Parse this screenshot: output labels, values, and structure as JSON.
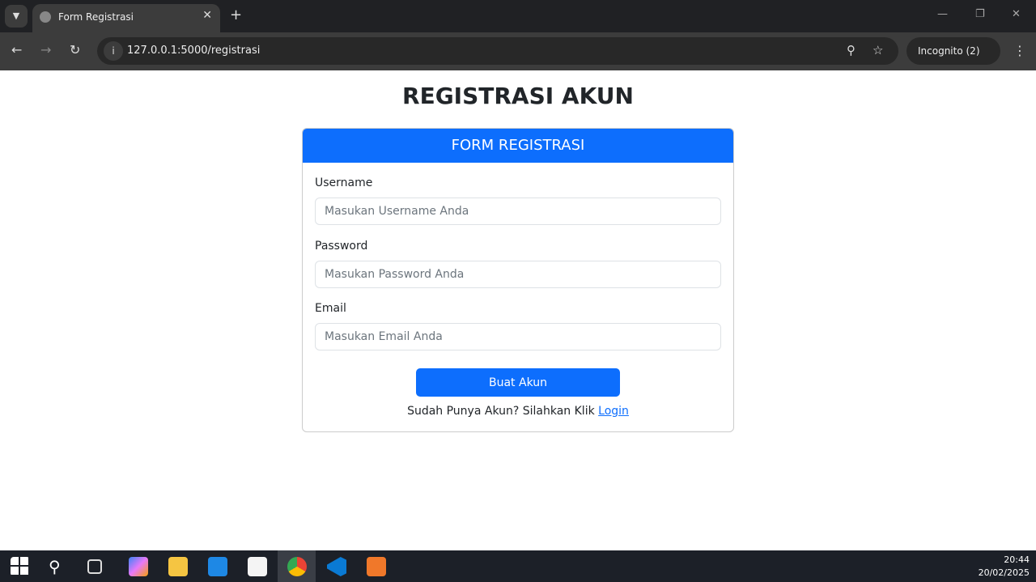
{
  "browser": {
    "tab_title": "Form Registrasi",
    "url": "127.0.0.1:5000/registrasi",
    "incognito_label": "Incognito (2)"
  },
  "page": {
    "title": "REGISTRASI AKUN",
    "card_header": "FORM REGISTRASI",
    "fields": [
      {
        "label": "Username",
        "placeholder": "Masukan Username Anda"
      },
      {
        "label": "Password",
        "placeholder": "Masukan Password Anda"
      },
      {
        "label": "Email",
        "placeholder": "Masukan Email Anda"
      }
    ],
    "submit_label": "Buat Akun",
    "footer_text": "Sudah Punya Akun? Silahkan Klik ",
    "login_link": "Login"
  },
  "taskbar": {
    "time": "20:44",
    "date": "20/02/2025",
    "icons": [
      "windows-start",
      "search",
      "task-view",
      "copilot",
      "file-explorer",
      "mail",
      "store",
      "chrome",
      "vscode",
      "xampp"
    ]
  },
  "colors": {
    "primary": "#0d6efd"
  }
}
